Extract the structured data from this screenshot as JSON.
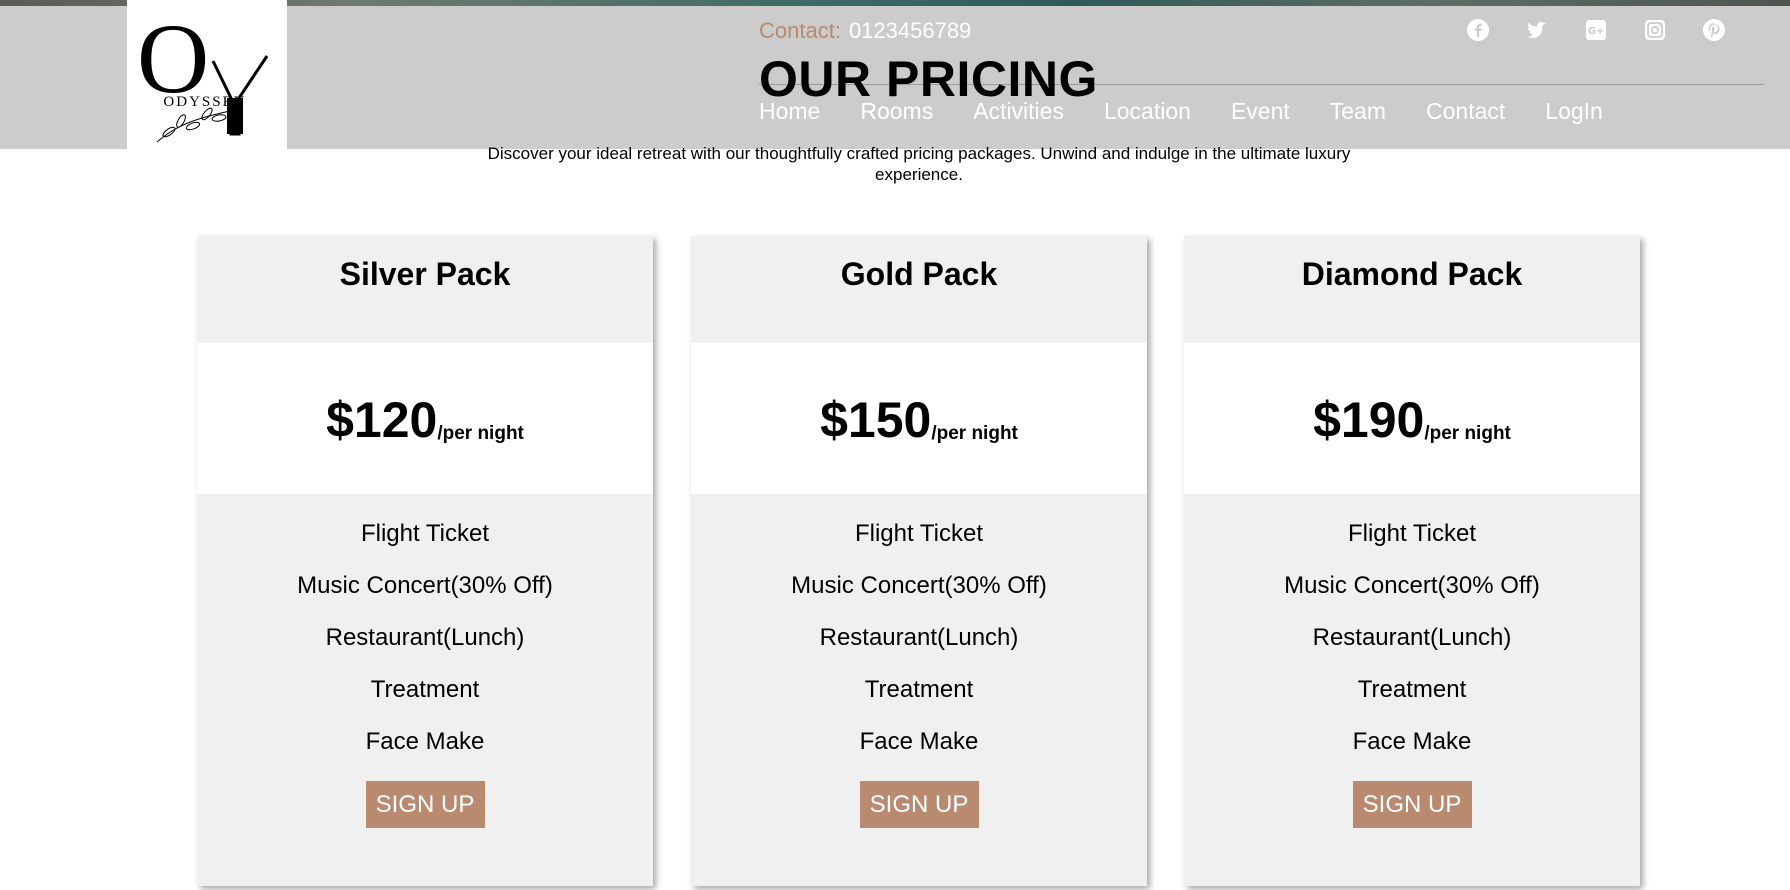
{
  "brand": {
    "logo_text": "ODYSSEY",
    "monogram": "OY"
  },
  "header": {
    "contact_label": "Contact:",
    "contact_number": "0123456789",
    "socials": [
      "facebook-icon",
      "twitter-icon",
      "google-plus-icon",
      "instagram-icon",
      "pinterest-icon"
    ],
    "nav": [
      "Home",
      "Rooms",
      "Activities",
      "Location",
      "Event",
      "Team",
      "Contact",
      "LogIn"
    ]
  },
  "main": {
    "title": "OUR PRICING",
    "subtitle": "Discover your ideal retreat with our thoughtfully crafted pricing packages. Unwind and indulge in the ultimate luxury experience."
  },
  "plans": [
    {
      "name": "Silver Pack",
      "price": "$120",
      "unit": "/per night",
      "features": [
        "Flight Ticket",
        "Music Concert(30% Off)",
        "Restaurant(Lunch)",
        "Treatment",
        "Face Make"
      ],
      "cta": "SIGN UP"
    },
    {
      "name": "Gold Pack",
      "price": "$150",
      "unit": "/per night",
      "features": [
        "Flight Ticket",
        "Music Concert(30% Off)",
        "Restaurant(Lunch)",
        "Treatment",
        "Face Make"
      ],
      "cta": "SIGN UP"
    },
    {
      "name": "Diamond Pack",
      "price": "$190",
      "unit": "/per night",
      "features": [
        "Flight Ticket",
        "Music Concert(30% Off)",
        "Restaurant(Lunch)",
        "Treatment",
        "Face Make"
      ],
      "cta": "SIGN UP"
    }
  ],
  "colors": {
    "accent": "#b98a70",
    "header_bg": "#cccccc",
    "card_bg": "#f0f0f0"
  }
}
